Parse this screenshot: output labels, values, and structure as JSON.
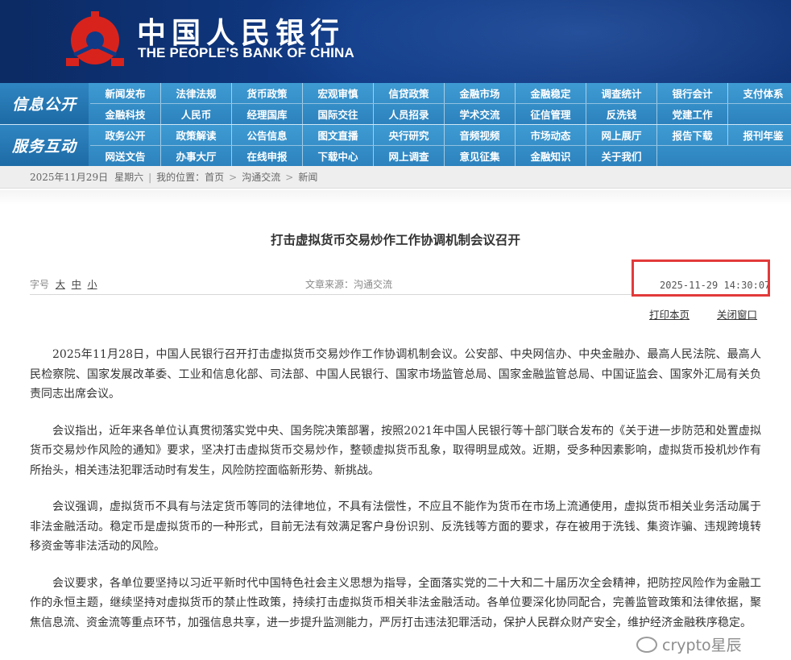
{
  "header": {
    "title_cn": "中国人民银行",
    "title_en": "THE PEOPLE'S BANK OF CHINA",
    "logo_icon": "pboc-emblem-icon"
  },
  "nav": {
    "group1_label": "信息公开",
    "group1_row1": [
      "新闻发布",
      "法律法规",
      "货币政策",
      "宏观审慎",
      "信贷政策",
      "金融市场",
      "金融稳定",
      "调查统计",
      "银行会计",
      "支付体系"
    ],
    "group1_row2": [
      "金融科技",
      "人民币",
      "经理国库",
      "国际交往",
      "人员招录",
      "学术交流",
      "征信管理",
      "反洗钱",
      "党建工作"
    ],
    "group2_label": "服务互动",
    "group2_row1": [
      "政务公开",
      "政策解读",
      "公告信息",
      "图文直播",
      "央行研究",
      "音频视频",
      "市场动态",
      "网上展厅",
      "报告下载",
      "报刊年鉴"
    ],
    "group2_row2": [
      "网送文告",
      "办事大厅",
      "在线申报",
      "下载中心",
      "网上调查",
      "意见征集",
      "金融知识",
      "关于我们"
    ]
  },
  "breadcrumb": {
    "date": "2025年11月29日",
    "weekday": "星期六",
    "location_label": "我的位置：首页",
    "level2": "沟通交流",
    "level3": "新闻"
  },
  "article": {
    "title": "打击虚拟货币交易炒作工作协调机制会议召开",
    "fontsize_label": "字号",
    "fontsize_large": "大",
    "fontsize_medium": "中",
    "fontsize_small": "小",
    "source": "文章来源：沟通交流",
    "datetime": "2025-11-29 14:30:07",
    "print_label": "打印本页",
    "close_label": "关闭窗口",
    "paragraphs": [
      "2025年11月28日，中国人民银行召开打击虚拟货币交易炒作工作协调机制会议。公安部、中央网信办、中央金融办、最高人民法院、最高人民检察院、国家发展改革委、工业和信息化部、司法部、中国人民银行、国家市场监管总局、国家金融监管总局、中国证监会、国家外汇局有关负责同志出席会议。",
      "会议指出，近年来各单位认真贯彻落实党中央、国务院决策部署，按照2021年中国人民银行等十部门联合发布的《关于进一步防范和处置虚拟货币交易炒作风险的通知》要求，坚决打击虚拟货币交易炒作，整顿虚拟货币乱象，取得明显成效。近期，受多种因素影响，虚拟货币投机炒作有所抬头，相关违法犯罪活动时有发生，风险防控面临新形势、新挑战。",
      "会议强调，虚拟货币不具有与法定货币等同的法律地位，不具有法偿性，不应且不能作为货币在市场上流通使用，虚拟货币相关业务活动属于非法金融活动。稳定币是虚拟货币的一种形式，目前无法有效满足客户身份识别、反洗钱等方面的要求，存在被用于洗钱、集资诈骗、违规跨境转移资金等非法活动的风险。",
      "会议要求，各单位要坚持以习近平新时代中国特色社会主义思想为指导，全面落实党的二十大和二十届历次全会精神，把防控风险作为金融工作的永恒主题，继续坚持对虚拟货币的禁止性政策，持续打击虚拟货币相关非法金融活动。各单位要深化协同配合，完善监管政策和法律依据，聚焦信息流、资金流等重点环节，加强信息共享，进一步提升监测能力，严厉打击违法犯罪活动，保护人民群众财产安全，维护经济金融秩序稳定。"
    ]
  },
  "watermark": {
    "text": "crypto星辰",
    "icon": "wechat-channel-icon"
  },
  "colors": {
    "banner": "#103a86",
    "nav": "#3f9bd3",
    "highlight_box": "#e23a3a"
  }
}
